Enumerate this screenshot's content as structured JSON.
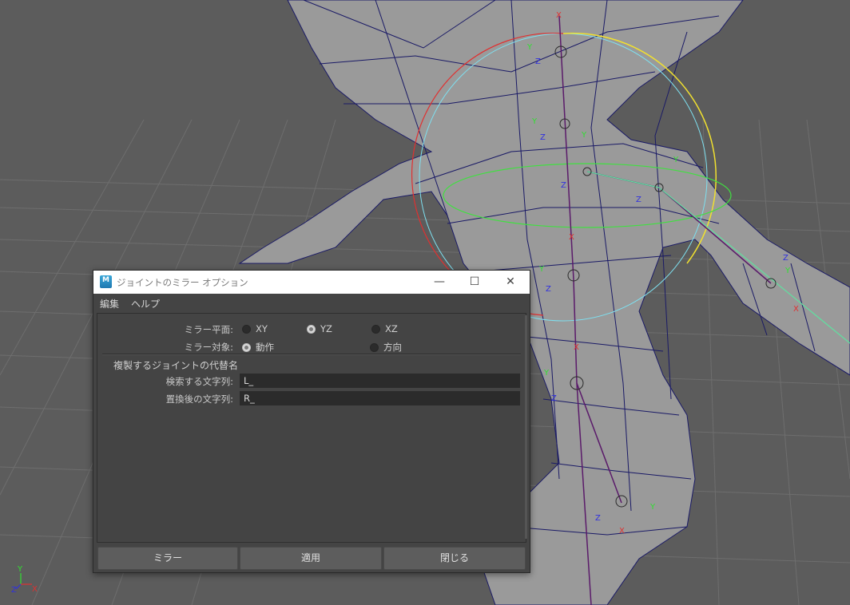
{
  "viewport": {
    "axis_labels": {
      "x": "X",
      "y": "Y",
      "z": "Z"
    },
    "colors": {
      "background": "#5c5c5c",
      "grid": "#6b6b6b",
      "mesh_fill": "#9a9a9a",
      "wire": "#1a1a66"
    }
  },
  "dialog": {
    "app_icon": "M",
    "title": "ジョイントのミラー オプション",
    "window_buttons": {
      "minimize": "—",
      "maximize": "☐",
      "close": "✕"
    },
    "menu": {
      "edit": "編集",
      "help": "ヘルプ"
    },
    "mirror_plane": {
      "label": "ミラー平面:",
      "options": [
        "XY",
        "YZ",
        "XZ"
      ],
      "selected": "YZ"
    },
    "mirror_target": {
      "label": "ミラー対象:",
      "options": [
        "動作",
        "方向"
      ],
      "selected": "動作"
    },
    "replacement": {
      "section_title": "複製するジョイントの代替名",
      "search_label": "検索する文字列:",
      "search_value": "L_",
      "replace_label": "置換後の文字列:",
      "replace_value": "R_"
    },
    "buttons": {
      "mirror": "ミラー",
      "apply": "適用",
      "close": "閉じる"
    }
  }
}
